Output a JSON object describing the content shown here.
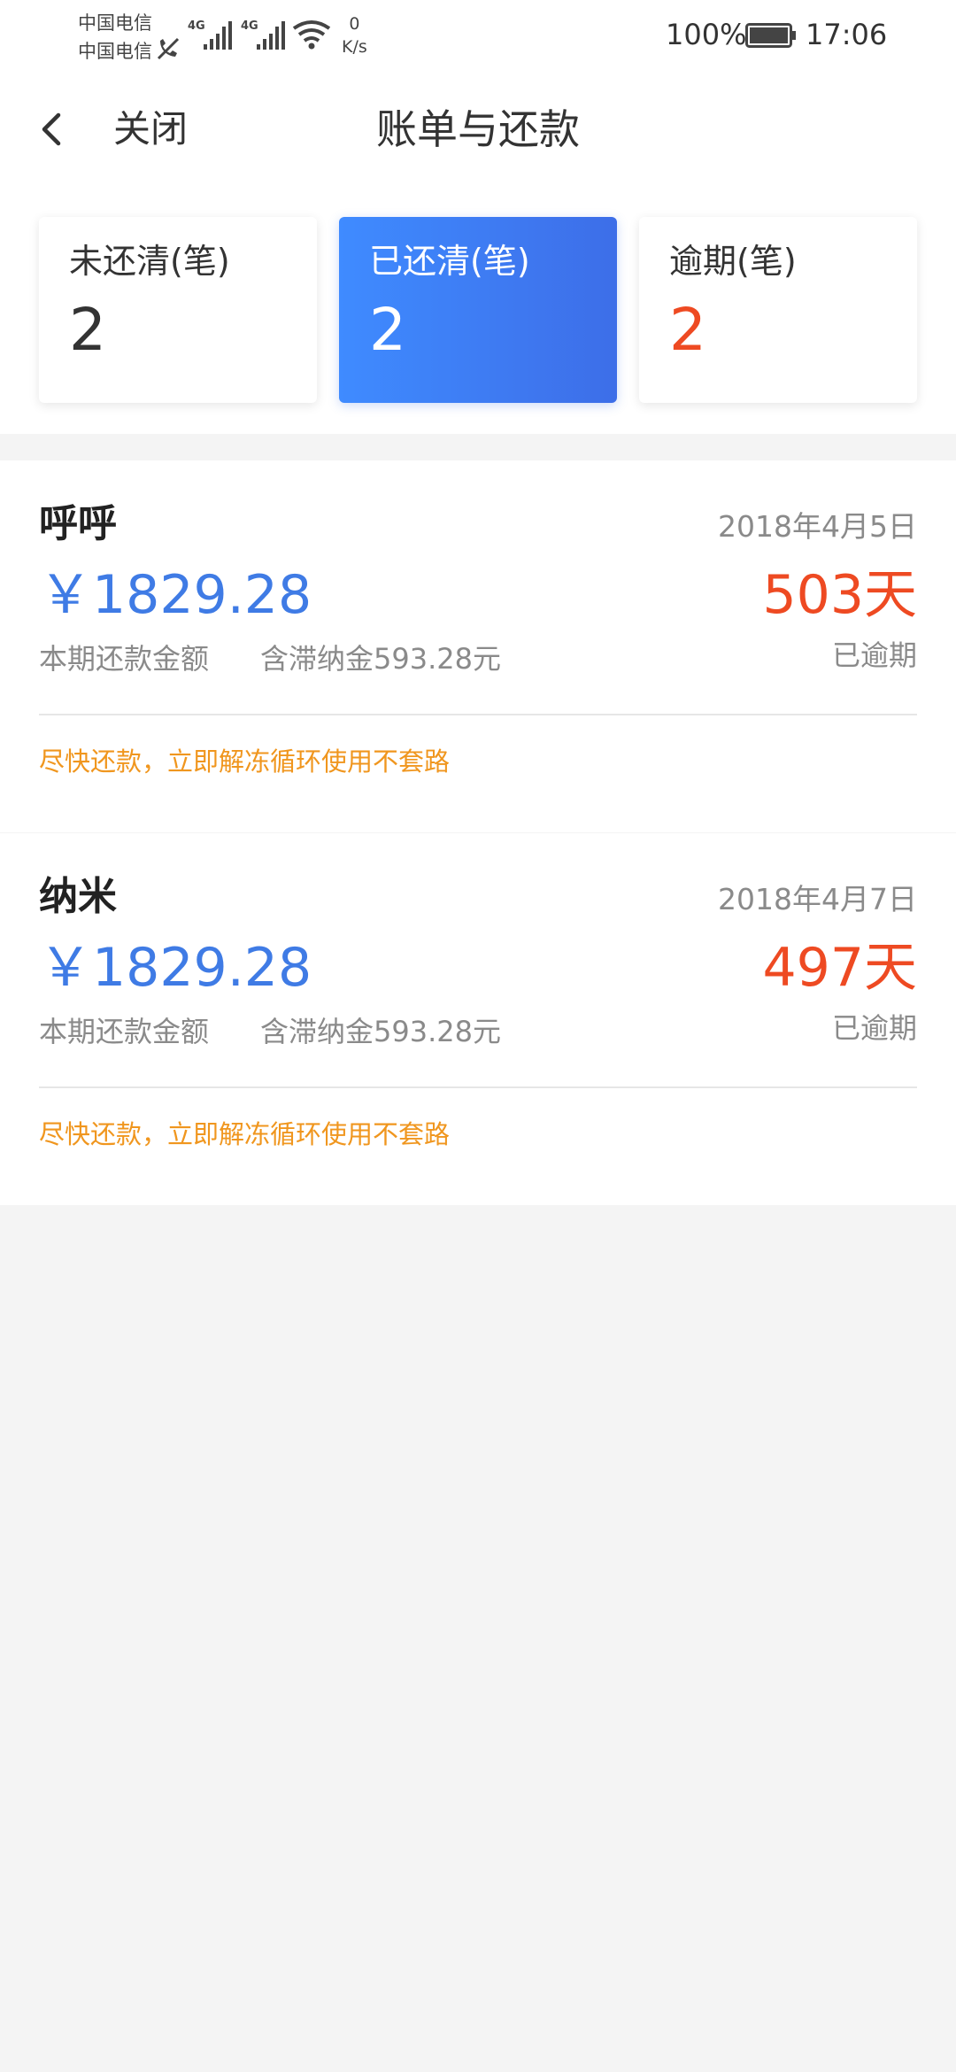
{
  "status_bar": {
    "carrier_1": "中国电信",
    "carrier_2": "中国电信",
    "network_1": "4G",
    "network_2": "4G",
    "speed_value": "0",
    "speed_unit": "K/s",
    "battery": "100%",
    "time": "17:06"
  },
  "nav": {
    "close_label": "关闭",
    "title": "账单与还款"
  },
  "tabs": [
    {
      "label": "未还清(笔)",
      "count": "2"
    },
    {
      "label": "已还清(笔)",
      "count": "2"
    },
    {
      "label": "逾期(笔)",
      "count": "2"
    }
  ],
  "bills": [
    {
      "name": "呼呼",
      "date": "2018年4月5日",
      "amount": "￥1829.28",
      "amount_label": "本期还款金额",
      "late_fee": "含滞纳金593.28元",
      "overdue_days": "503天",
      "overdue_label": "已逾期",
      "tip": "尽快还款，立即解冻循环使用不套路"
    },
    {
      "name": "纳米",
      "date": "2018年4月7日",
      "amount": "￥1829.28",
      "amount_label": "本期还款金额",
      "late_fee": "含滞纳金593.28元",
      "overdue_days": "497天",
      "overdue_label": "已逾期",
      "tip": "尽快还款，立即解冻循环使用不套路"
    }
  ],
  "colors": {
    "accent_blue": "#3f7be5",
    "overdue_red": "#ee4a22",
    "tip_orange": "#f0961e",
    "background": "#f4f4f4"
  }
}
